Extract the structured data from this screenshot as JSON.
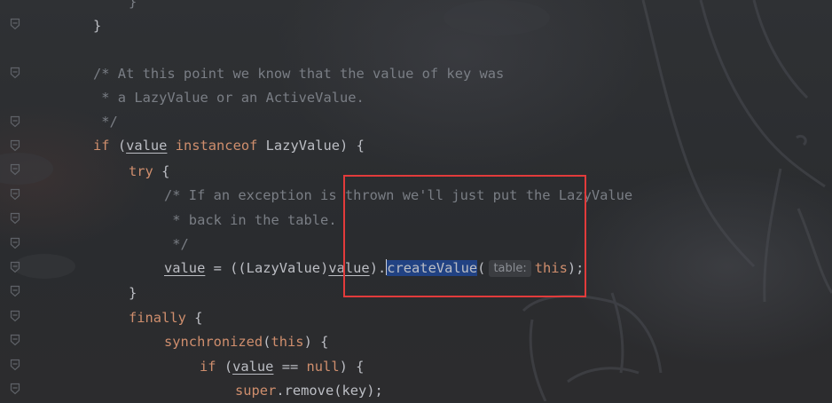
{
  "editor": {
    "lines": [
      [
        [
          "cm",
          "}"
        ]
      ],
      [
        [
          "id",
          "}"
        ]
      ],
      [],
      [
        [
          "cm",
          "/* At this point we know that the value of key was"
        ]
      ],
      [
        [
          "cm",
          " * a LazyValue or an ActiveValue."
        ]
      ],
      [
        [
          "cm",
          " */"
        ]
      ],
      [
        [
          "kw",
          "if"
        ],
        [
          "id",
          " ("
        ],
        [
          "ul",
          "value"
        ],
        [
          "kw",
          " instanceof"
        ],
        [
          "id",
          " LazyValue) {"
        ]
      ],
      [
        [
          "kw",
          "try"
        ],
        [
          "id",
          " {"
        ]
      ],
      [
        [
          "cm",
          "/* If an exception is thrown we'll just put the LazyValue"
        ]
      ],
      [
        [
          "cm",
          " * back in the table."
        ]
      ],
      [
        [
          "cm",
          " */"
        ]
      ],
      [
        [
          "ul",
          "value"
        ],
        [
          "id",
          " = ((LazyValue)"
        ],
        [
          "ul",
          "value"
        ],
        [
          "id",
          ")."
        ],
        [
          "caret",
          ""
        ],
        [
          "sel",
          "createValue"
        ],
        [
          "id",
          "("
        ],
        [
          "hint",
          "table:"
        ],
        [
          "kw",
          "this"
        ],
        [
          "id",
          ");"
        ]
      ],
      [
        [
          "id",
          "}"
        ]
      ],
      [
        [
          "kw",
          "finally"
        ],
        [
          "id",
          " {"
        ]
      ],
      [
        [
          "kw",
          "synchronized"
        ],
        [
          "id",
          "("
        ],
        [
          "kw",
          "this"
        ],
        [
          "id",
          ") {"
        ]
      ],
      [
        [
          "kw",
          "if"
        ],
        [
          "id",
          " ("
        ],
        [
          "ul",
          "value"
        ],
        [
          "id",
          " == "
        ],
        [
          "kw",
          "null"
        ],
        [
          "id",
          ") {"
        ]
      ],
      [
        [
          "kw",
          "super"
        ],
        [
          "id",
          ".remove(key);"
        ]
      ]
    ]
  },
  "colors": {
    "keyword": "#cf8e6d",
    "comment": "#7a7e85",
    "identifier": "#bcbec4",
    "selection": "#214283",
    "callout": "#e23b3b"
  },
  "icons": {
    "gutter_fold": "fold-marker-icon"
  }
}
